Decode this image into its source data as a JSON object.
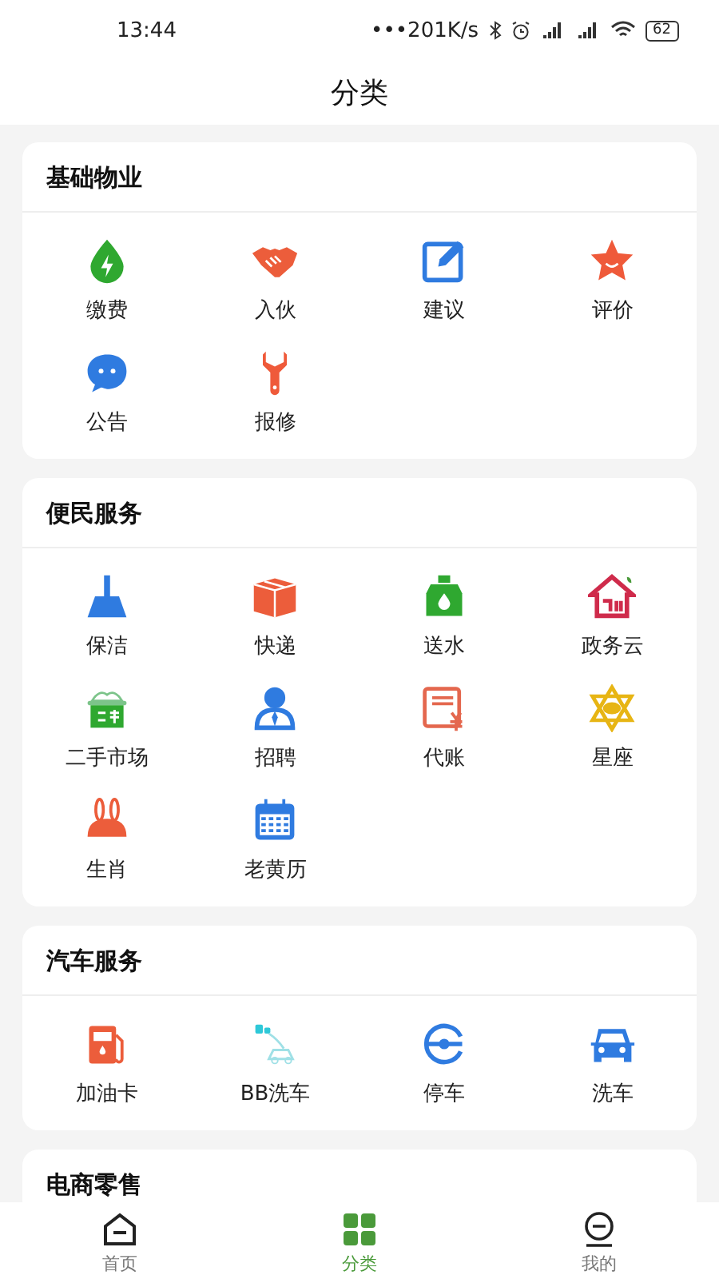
{
  "status_bar": {
    "time": "13:44",
    "speed": "•••201K/s",
    "battery": "62"
  },
  "header": {
    "title": "分类"
  },
  "sections": [
    {
      "title": "基础物业",
      "items": [
        {
          "label": "缴费"
        },
        {
          "label": "入伙"
        },
        {
          "label": "建议"
        },
        {
          "label": "评价"
        },
        {
          "label": "公告"
        },
        {
          "label": "报修"
        }
      ]
    },
    {
      "title": "便民服务",
      "items": [
        {
          "label": "保洁"
        },
        {
          "label": "快递"
        },
        {
          "label": "送水"
        },
        {
          "label": "政务云"
        },
        {
          "label": "二手市场"
        },
        {
          "label": "招聘"
        },
        {
          "label": "代账"
        },
        {
          "label": "星座"
        },
        {
          "label": "生肖"
        },
        {
          "label": "老黄历"
        }
      ]
    },
    {
      "title": "汽车服务",
      "items": [
        {
          "label": "加油卡"
        },
        {
          "label": "BB洗车"
        },
        {
          "label": "停车"
        },
        {
          "label": "洗车"
        }
      ]
    },
    {
      "title": "电商零售"
    }
  ],
  "tab_bar": [
    {
      "label": "首页",
      "selected": false
    },
    {
      "label": "分类",
      "selected": true
    },
    {
      "label": "我的",
      "selected": false
    }
  ]
}
